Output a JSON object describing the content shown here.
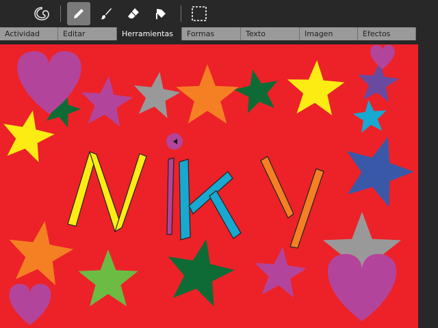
{
  "toolbar": {
    "tools": [
      {
        "name": "activity-icon",
        "active": false
      },
      {
        "name": "pencil-icon",
        "active": true
      },
      {
        "name": "brush-icon",
        "active": false
      },
      {
        "name": "eraser-icon",
        "active": false
      },
      {
        "name": "bucket-icon",
        "active": false
      },
      {
        "name": "select-icon",
        "active": false
      }
    ]
  },
  "tabs": [
    {
      "label": "Actividad",
      "active": false
    },
    {
      "label": "Editar",
      "active": false
    },
    {
      "label": "Herramientas",
      "active": true
    },
    {
      "label": "Formas",
      "active": false
    },
    {
      "label": "Texto",
      "active": false
    },
    {
      "label": "Imagen",
      "active": false
    },
    {
      "label": "Efectos",
      "active": false
    }
  ],
  "canvas": {
    "background": "#ec2228",
    "colors": {
      "purple": "#b3449b",
      "gray": "#999999",
      "orange": "#f58024",
      "darkgreen": "#0e6b35",
      "yellow": "#fcec14",
      "blue": "#3a58a8",
      "cyan": "#18a8d0",
      "lime": "#6cbc44",
      "indigo": "#6a4aa0"
    }
  }
}
